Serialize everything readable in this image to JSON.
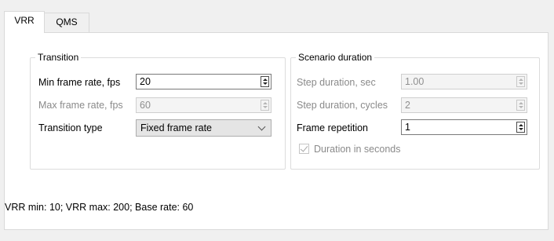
{
  "tabs": [
    {
      "label": "VRR",
      "active": true
    },
    {
      "label": "QMS",
      "active": false
    }
  ],
  "transition": {
    "title": "Transition",
    "min_frame_rate": {
      "label": "Min frame rate, fps",
      "value": "20",
      "enabled": true
    },
    "max_frame_rate": {
      "label": "Max frame rate, fps",
      "value": "60",
      "enabled": false
    },
    "transition_type": {
      "label": "Transition type",
      "value": "Fixed frame rate"
    }
  },
  "scenario": {
    "title": "Scenario duration",
    "step_duration_sec": {
      "label": "Step duration, sec",
      "value": "1.00",
      "enabled": false
    },
    "step_duration_cycles": {
      "label": "Step duration, cycles",
      "value": "2",
      "enabled": false
    },
    "frame_repetition": {
      "label": "Frame repetition",
      "value": "1",
      "enabled": true
    },
    "duration_in_seconds": {
      "label": "Duration in seconds",
      "checked": true,
      "enabled": false
    }
  },
  "status_text": "VRR min: 10; VRR max: 200;  Base rate: 60",
  "icons": {
    "spin_up": "spin-up-arrow-icon",
    "spin_down": "spin-down-arrow-icon",
    "dropdown": "chevron-down-icon",
    "checkbox": "checkmark-icon"
  },
  "colors": {
    "window_bg": "#f0f0f0",
    "pane_bg": "#ffffff",
    "disabled_text": "#8a8a8a",
    "combo_bg": "#e5e5e5"
  }
}
